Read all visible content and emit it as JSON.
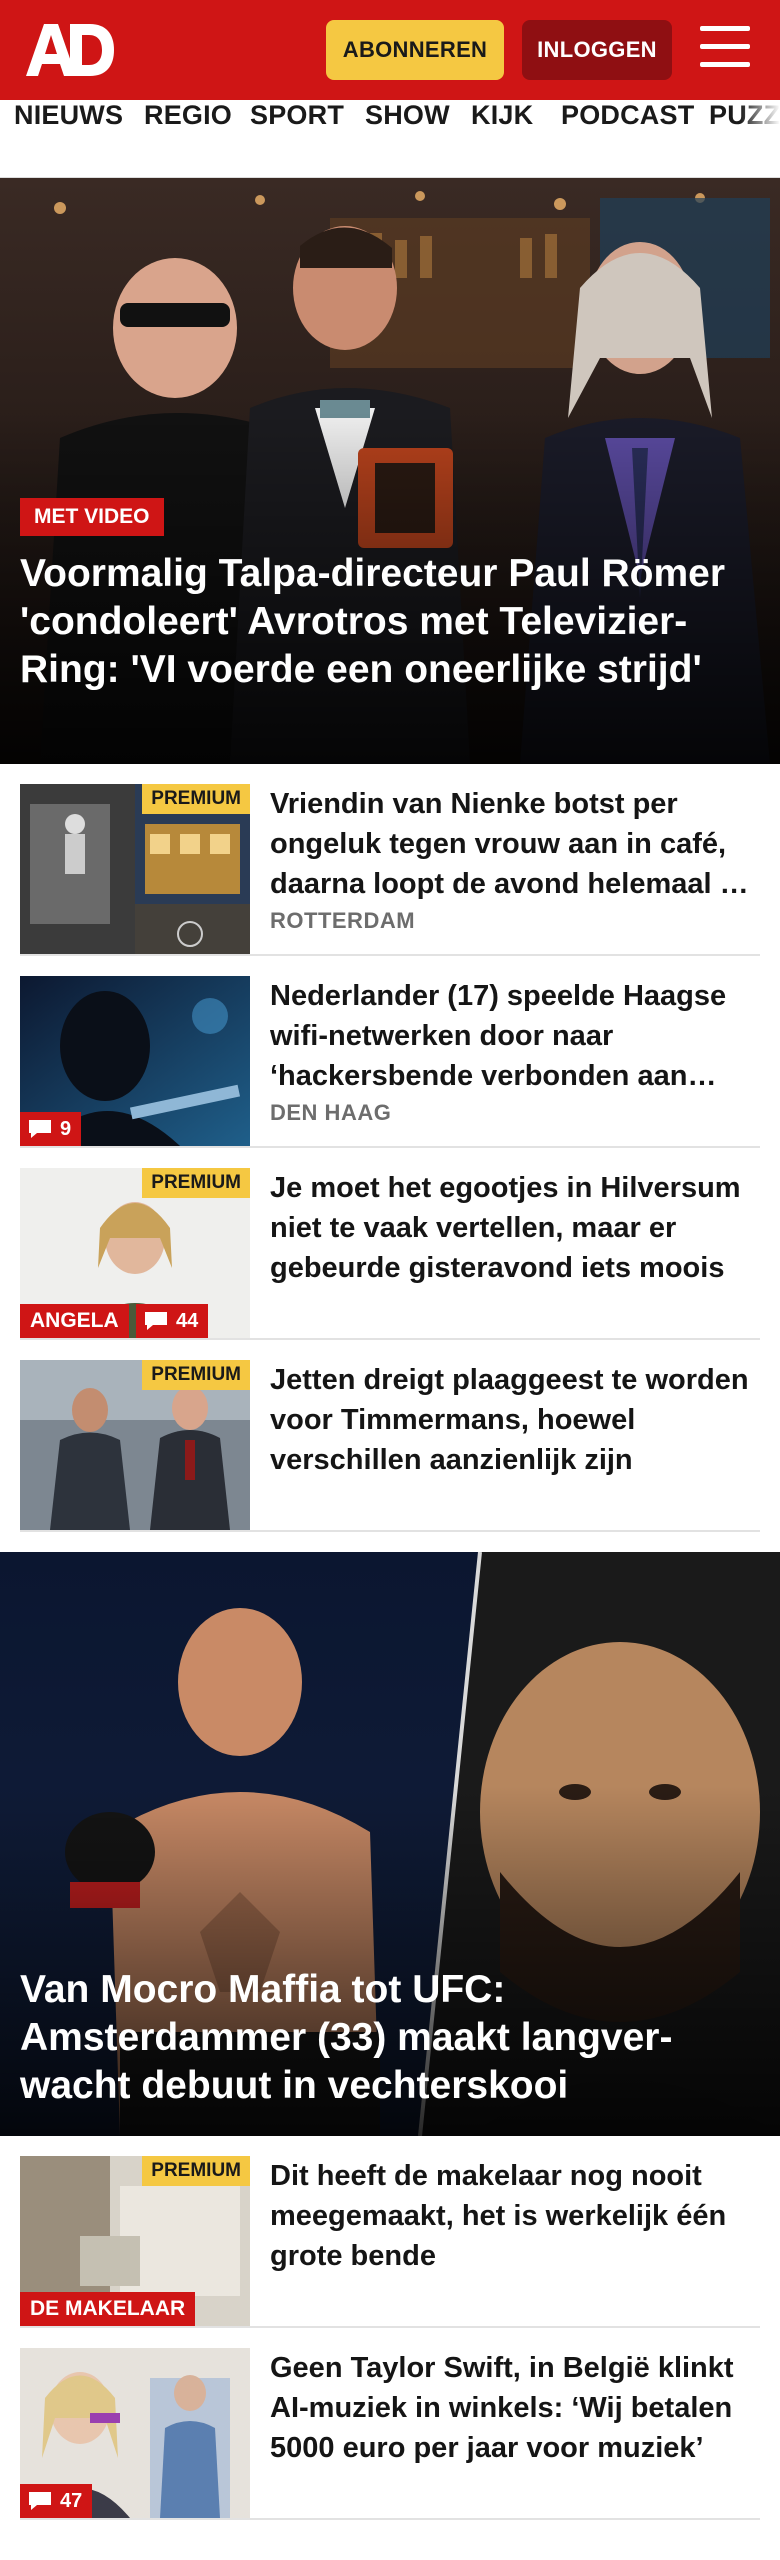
{
  "header": {
    "logo_text": "AD",
    "subscribe_label": "ABONNEREN",
    "login_label": "INLOGGEN",
    "menu_icon": "hamburger-menu-icon"
  },
  "nav": {
    "items": [
      "NIEUWS",
      "REGIO",
      "SPORT",
      "SHOW",
      "KIJK",
      "PODCAST",
      "PUZZ"
    ]
  },
  "hero1": {
    "badge": "MET VIDEO",
    "title": "Voormalig Talpa-directeur Paul Römer 'condoleert' Avrotros met Televizier-Ring: 'VI voerde een oneerlijke strijd'"
  },
  "articles": [
    {
      "premium": "PREMIUM",
      "headline": "Vriendin van Nienke botst per ongeluk tegen vrouw aan in café, daarna loopt de avond helemaal uit de hand",
      "location": "ROTTERDAM"
    },
    {
      "comments": "9",
      "headline": "Nederlander (17) speelde Haagse wifi-netwerken door naar ‘hackersbende verbonden aan Rusland’",
      "location": "DEN HAAG"
    },
    {
      "premium": "PREMIUM",
      "section": "ANGELA",
      "comments": "44",
      "headline": "Je moet het egootjes in Hilversum niet te vaak vertellen, maar er gebeurde gisteravond iets moois"
    },
    {
      "premium": "PREMIUM",
      "headline": "Jetten dreigt plaaggeest te worden voor Timmermans, hoewel verschillen aanzienlijk zijn"
    }
  ],
  "hero2": {
    "title": "Van Mocro Maffia tot UFC: Amsterdammer (33) maakt langver­wacht debuut in vechterskooi"
  },
  "articles2": [
    {
      "premium": "PREMIUM",
      "section": "DE MAKELAAR",
      "headline": "Dit heeft de makelaar nog nooit meegemaakt, het is werkelijk één grote bende"
    },
    {
      "comments": "47",
      "headline": "Geen Taylor Swift, in België klinkt AI-muziek in winkels: ‘Wij betalen 5000 euro per jaar voor muziek’"
    }
  ],
  "colors": {
    "brand_red": "#cf1515",
    "premium_yellow": "#f5c842",
    "login_dark_red": "#8f0f12"
  }
}
